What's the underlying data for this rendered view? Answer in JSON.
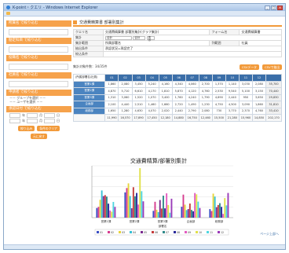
{
  "window": {
    "title": "K-point・クエリ - Windows Internet Explorer"
  },
  "sidebar": {
    "sections": [
      {
        "head": "所属名 で絞り込む"
      },
      {
        "head": "勘定科目 で絞り込む"
      },
      {
        "head": "役職名 で絞り込む"
      },
      {
        "head": "社員名 で絞り込む"
      }
    ],
    "group_head": "申請者 で絞り込む",
    "group_select": "－－ グループを選択 －－",
    "user_select": "－－ ユーザを選択 －－",
    "date_head": "承認日付 で絞り込む",
    "date_from": {
      "y": "年",
      "m": "月",
      "d": "日"
    },
    "date_to": {
      "y": "年",
      "m": "月",
      "d": "日"
    },
    "search_button": "絞り込み",
    "clear_button": "条件のクリア",
    "reset_button": "元に戻す"
  },
  "main": {
    "page_title": "交通費精算書  部署別集計",
    "cond_rows": [
      {
        "label": "クエリ名",
        "value": "交通費精算書 部署別集計(グラフ集計)",
        "label2": "フォーム名",
        "value2": "交通費精算書"
      },
      {
        "label": "集計",
        "value": "合計",
        "label2": "",
        "value2": ""
      },
      {
        "label": "集計範囲",
        "value": "所属部署名",
        "label2": "列範囲",
        "value2": "社員"
      },
      {
        "label": "抽出条件",
        "value": "承認状況=承認完了",
        "label2": "",
        "value2": ""
      },
      {
        "label": "絞込条件",
        "value": "",
        "label2": "",
        "value2": ""
      }
    ],
    "sum_ctl": "合計",
    "axis_ctl": "合計",
    "show_button": "表示",
    "result_count": "集計対象件数：34/35件",
    "csv_button": "CSVデータ",
    "csv_button2": "CSVで抽出"
  },
  "matrix": {
    "corner": "(所属部署名/社員)",
    "columns": [
      "01",
      "02",
      "03",
      "04",
      "05",
      "06",
      "07",
      "08",
      "09",
      "10",
      "11",
      "12"
    ],
    "rows": [
      {
        "name": "営業1課",
        "values": [
          "1,860",
          "2,080",
          "3,450",
          "5,240",
          "4,160",
          "4,340",
          "4,060",
          "2,700",
          "1,370",
          "1,140",
          "3,030",
          "2,080",
          "35,700"
        ]
      },
      {
        "name": "営業2課",
        "values": [
          "4,870",
          "5,710",
          "6,610",
          "4,170",
          "1,810",
          "5,870",
          "4,120",
          "4,760",
          "2,530",
          "9,540",
          "5,100",
          "3,150",
          "70,440"
        ]
      },
      {
        "name": "営業3課",
        "values": [
          "1,310",
          "3,060",
          "1,520",
          "1,070",
          "3,400",
          "1,760",
          "4,240",
          "1,790",
          "4,690",
          "2,440",
          "950",
          "3,650",
          "29,830"
        ]
      },
      {
        "name": "企画部",
        "values": [
          "2,100",
          "4,440",
          "2,510",
          "1,460",
          "1,660",
          "2,720",
          "1,490",
          "1,230",
          "4,750",
          "4,500",
          "3,090",
          "1,860",
          "31,810"
        ]
      },
      {
        "name": "総務部",
        "values": [
          "1,650",
          "1,280",
          "4,630",
          "4,070",
          "2,020",
          "2,440",
          "2,790",
          "2,080",
          "730",
          "3,770",
          "2,370",
          "4,760",
          "33,410"
        ]
      }
    ],
    "totals": [
      "11,990",
      "16,570",
      "17,890",
      "17,450",
      "12,180",
      "14,880",
      "16,750",
      "12,460",
      "15,500",
      "21,280",
      "15,960",
      "14,850",
      "202,170"
    ]
  },
  "chart_data": {
    "type": "bar",
    "title": "交通費精算/部署別集計",
    "categories": [
      "営業1課",
      "営業2課",
      "営業3課",
      "企画部",
      "総務部"
    ],
    "xlabel": "部署名",
    "ylim": [
      0,
      10000
    ],
    "series": [
      {
        "name": "01",
        "values": [
          1860,
          4870,
          1310,
          2100,
          1650
        ]
      },
      {
        "name": "02",
        "values": [
          2080,
          5710,
          3060,
          4440,
          1280
        ]
      },
      {
        "name": "03",
        "values": [
          3450,
          6610,
          1520,
          2510,
          4630
        ]
      },
      {
        "name": "04",
        "values": [
          5240,
          4170,
          1070,
          1460,
          4070
        ]
      },
      {
        "name": "05",
        "values": [
          4160,
          1810,
          3400,
          1660,
          2020
        ]
      },
      {
        "name": "06",
        "values": [
          4340,
          5870,
          1760,
          2720,
          2440
        ]
      },
      {
        "name": "07",
        "values": [
          4060,
          4120,
          4240,
          1490,
          2790
        ]
      },
      {
        "name": "08",
        "values": [
          2700,
          4760,
          1790,
          1230,
          2080
        ]
      },
      {
        "name": "09",
        "values": [
          1370,
          2530,
          4690,
          4750,
          730
        ]
      },
      {
        "name": "10",
        "values": [
          1140,
          9540,
          2440,
          4500,
          3770
        ]
      },
      {
        "name": "11",
        "values": [
          3030,
          5100,
          950,
          3090,
          2370
        ]
      },
      {
        "name": "12",
        "values": [
          2080,
          3150,
          3650,
          1860,
          4760
        ]
      }
    ],
    "colors": [
      "#3b4fc4",
      "#d63c8f",
      "#e8d43a",
      "#36c2d6",
      "#7a2a8f",
      "#c43b3b",
      "#2f8a8a",
      "#2a2a9a",
      "#e35bc0",
      "#e0e04a",
      "#4fd6e0",
      "#9a3ab8"
    ],
    "legend": "bottom",
    "grid": true
  },
  "footer": {
    "page_top": "ページ上部へ"
  }
}
